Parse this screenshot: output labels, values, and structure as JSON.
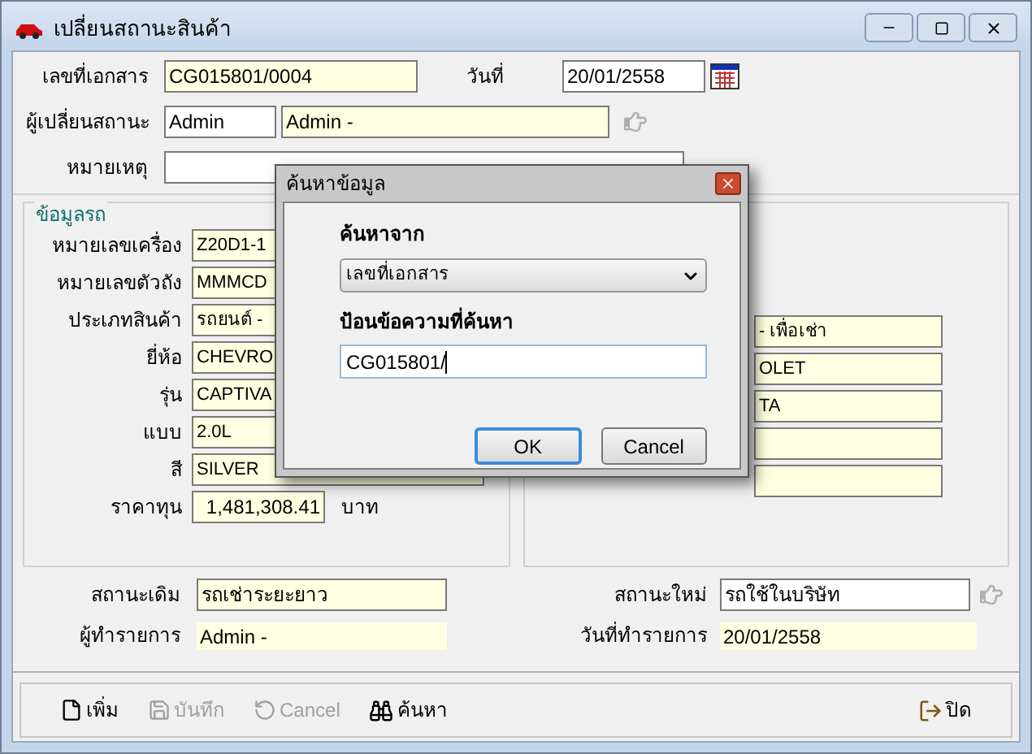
{
  "window": {
    "title": "เปลี่ยนสถานะสินค้า"
  },
  "header": {
    "doc_no": {
      "label": "เลขที่เอกสาร",
      "value": "CG015801/0004"
    },
    "date": {
      "label": "วันที่",
      "value": "20/01/2558"
    },
    "changer": {
      "label": "ผู้เปลี่ยนสถานะ",
      "code": "Admin",
      "name": "Admin -"
    },
    "note": {
      "label": "หมายเหตุ"
    }
  },
  "car_info": {
    "title": "ข้อมูลรถ",
    "fields": [
      {
        "label": "หมายเลขเครื่อง",
        "value": "Z20D1-1"
      },
      {
        "label": "หมายเลขตัวถัง",
        "value": "MMMCD"
      },
      {
        "label": "ประเภทสินค้า",
        "value": "รถยนต์ -"
      },
      {
        "label": "ยี่ห้อ",
        "value": "CHEVRO"
      },
      {
        "label": "รุ่น",
        "value": "CAPTIVA"
      },
      {
        "label": "แบบ",
        "value": "2.0L"
      },
      {
        "label": "สี",
        "value": "SILVER"
      }
    ],
    "cost": {
      "label": "ราคาทุน",
      "value": "1,481,308.41",
      "unit": "บาท"
    },
    "right_fields": [
      {
        "kind": "text",
        "value": "- เพื่อเช่า"
      },
      {
        "kind": "text",
        "value": "OLET"
      },
      {
        "kind": "text",
        "value": "TA"
      },
      {
        "kind": "blank"
      },
      {
        "kind": "blank"
      }
    ]
  },
  "status": {
    "old": {
      "label": "สถานะเดิม",
      "value": "รถเช่าระยะยาว"
    },
    "new": {
      "label": "สถานะใหม่",
      "value": "รถใช้ในบริษัท"
    },
    "operator": {
      "label": "ผู้ทำรายการ",
      "value": "Admin -"
    },
    "op_date": {
      "label": "วันที่ทำรายการ",
      "value": "20/01/2558"
    }
  },
  "toolbar": [
    {
      "kind": "new",
      "label": "เพิ่ม",
      "disabled": false
    },
    {
      "kind": "save",
      "label": "บันทึก",
      "disabled": true
    },
    {
      "kind": "cancel",
      "label": "Cancel",
      "disabled": true
    },
    {
      "kind": "search",
      "label": "ค้นหา",
      "disabled": false
    },
    {
      "kind": "close",
      "label": "ปิด",
      "disabled": false
    }
  ],
  "dialog": {
    "title": "ค้นหาข้อมูล",
    "search_from": {
      "label": "ค้นหาจาก",
      "value": "เลขที่เอกสาร"
    },
    "query": {
      "label": "ป้อนข้อความที่ค้นหา",
      "value": "CG015801/"
    },
    "buttons": [
      {
        "label": "OK",
        "focused": true
      },
      {
        "label": "Cancel",
        "focused": false
      }
    ]
  }
}
